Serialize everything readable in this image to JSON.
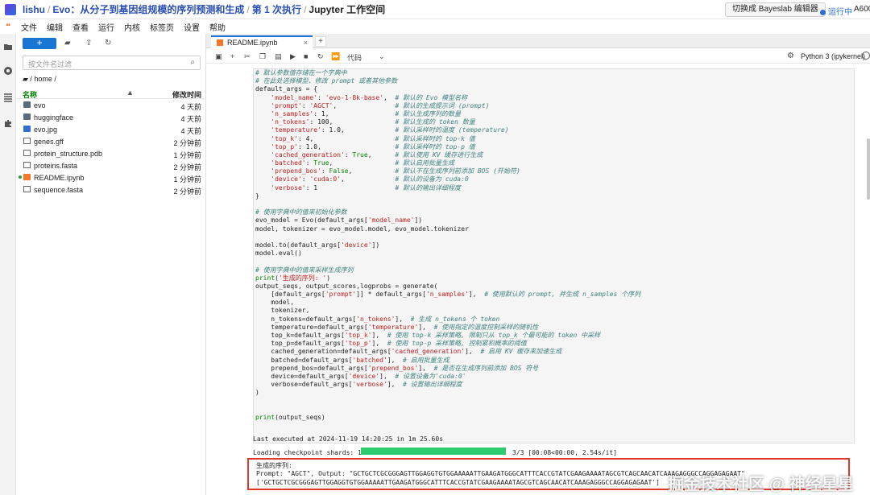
{
  "header": {
    "crumbs": [
      "lishu",
      "Evo：从分子到基因组规模的序列预测和生成",
      "第 1 次执行",
      "Jupyter 工作空间"
    ],
    "switch_label": "切换成 Bayeslab 编辑器",
    "status": "运行中",
    "gpu": "A600"
  },
  "menu": [
    "文件",
    "编辑",
    "查看",
    "运行",
    "内核",
    "标签页",
    "设置",
    "帮助"
  ],
  "files": {
    "new_label": "+",
    "filter_placeholder": "按文件名过滤",
    "path": "/ home /",
    "col_name": "名称",
    "col_time": "修改时间",
    "items": [
      {
        "name": "evo",
        "time": "4 天前",
        "icon": "folder-icon"
      },
      {
        "name": "huggingface",
        "time": "4 天前",
        "icon": "folder-icon"
      },
      {
        "name": "evo.jpg",
        "time": "4 天前",
        "icon": "image-icon"
      },
      {
        "name": "genes.gff",
        "time": "2 分钟前",
        "icon": "file-icon"
      },
      {
        "name": "protein_structure.pdb",
        "time": "1 分钟前",
        "icon": "file-icon"
      },
      {
        "name": "proteins.fasta",
        "time": "2 分钟前",
        "icon": "file-icon"
      },
      {
        "name": "README.ipynb",
        "time": "1 分钟前",
        "icon": "notebook-icon"
      },
      {
        "name": "sequence.fasta",
        "time": "2 分钟前",
        "icon": "file-icon"
      }
    ]
  },
  "notebook": {
    "tab_title": "README.ipynb",
    "cell_type": "代码",
    "kernel": "Python 3 (ipykernel)",
    "code_lines": [
      "# 默认参数值存储在一个字典中",
      "# 在此处选择模型、修改 prompt 或者其他参数",
      "default_args = {",
      "    'model_name': 'evo-1-8k-base',  # 默认的 Evo 模型名称",
      "    'prompt': 'AGCT',               # 默认的生成提示词 (prompt)",
      "    'n_samples': 1,                 # 默认生成序列的数量",
      "    'n_tokens': 100,                # 默认生成的 token 数量",
      "    'temperature': 1.0,             # 默认采样时的温度 (temperature)",
      "    'top_k': 4,                     # 默认采样时的 top-k 值",
      "    'top_p': 1.0,                   # 默认采样时的 top-p 值",
      "    'cached_generation': True,      # 默认使用 KV 缓存进行生成",
      "    'batched': True,                # 默认启用批量生成",
      "    'prepend_bos': False,           # 默认不在生成序列前添加 BOS (开始符)",
      "    'device': 'cuda:0',             # 默认的设备为 cuda:0",
      "    'verbose': 1                    # 默认的输出详细程度",
      "}",
      "",
      "# 使用字典中的值来初始化参数",
      "evo_model = Evo(default_args['model_name'])",
      "model, tokenizer = evo_model.model, evo_model.tokenizer",
      "",
      "model.to(default_args['device'])",
      "model.eval()",
      "",
      "# 使用字典中的值来采样生成序列",
      "print('生成的序列: ')",
      "output_seqs, output_scores,logprobs = generate(",
      "    [default_args['prompt']] * default_args['n_samples'],  # 使用默认的 prompt, 并生成 n_samples 个序列",
      "    model,",
      "    tokenizer,",
      "    n_tokens=default_args['n_tokens'],  # 生成 n_tokens 个 token",
      "    temperature=default_args['temperature'],  # 使用指定的温度控制采样的随机性",
      "    top_k=default_args['top_k'],  # 使用 top-k 采样策略, 限制只从 top_k 个最可能的 token 中采样",
      "    top_p=default_args['top_p'],  # 使用 top-p 采样策略, 控制累积概率的阈值",
      "    cached_generation=default_args['cached_generation'],  # 启用 KV 缓存来加速生成",
      "    batched=default_args['batched'],  # 启用批量生成",
      "    prepend_bos=default_args['prepend_bos'],  # 是否在生成序列前添加 BOS 符号",
      "    device=default_args['device'],  # 设置设备为'cuda:0'",
      "    verbose=default_args['verbose'],  # 设置输出详细程度",
      ")",
      "",
      "",
      "print(output_seqs)"
    ],
    "exec_info": "Last executed at 2024-11-19 14:20:25 in 1m 25.60s",
    "loading_label": "Loading checkpoint shards: 100%",
    "loading_progress": 1.0,
    "loading_tail": "3/3 [00:08<00:00,   2.54s/it]",
    "output_lines": [
      "生成的序列:",
      "Prompt: \"AGCT\", Output: \"GCTGCTCGCGGGAGTTGGAGGTGTGGAAAAATTGAAGATGGGCATTTCACCGTATCGAAGAAAATAGCGTCAGCAACATCAAAGAGGGCCAGGAGAGAAT\"",
      "['GCTGCTCGCGGGAGTTGGAGGTGTGGAAAAATTGAAGATGGGCATTTCACCGTATCGAAGAAAATAGCGTCAGCAACATCAAAGAGGGCCAGGAGAGAAT']"
    ],
    "watermark": "掘金技术社区 @ 神经星星"
  }
}
